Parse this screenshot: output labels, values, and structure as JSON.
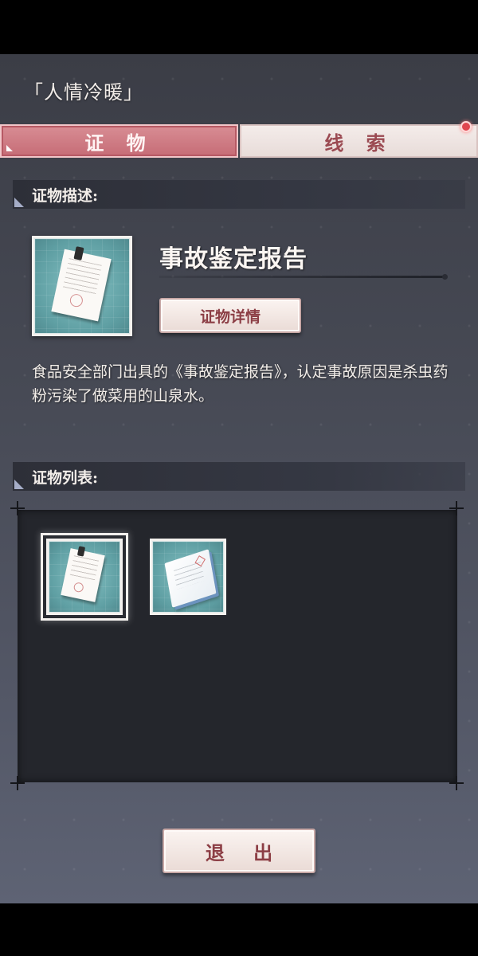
{
  "title": "「人情冷暖」",
  "tabs": [
    {
      "label": "证 物",
      "active": true
    },
    {
      "label": "线 索",
      "active": false,
      "has_notification": true
    }
  ],
  "evidence_description": {
    "header": "证物描述:",
    "item_name": "事故鉴定报告",
    "icon": "report-document-icon",
    "detail_button": "证物详情",
    "text": "食品安全部门出具的《事故鉴定报告》，认定事故原因是杀虫药粉污染了做菜用的山泉水。"
  },
  "evidence_list": {
    "header": "证物列表:",
    "items": [
      {
        "icon": "report-document-icon",
        "selected": true
      },
      {
        "icon": "notebook-icon",
        "selected": false
      }
    ]
  },
  "exit_button": "退 出",
  "colors": {
    "accent_pink": "#c66c76",
    "button_text": "#8c3e45",
    "notification": "#e0464f",
    "panel_bg": "#24262c"
  }
}
